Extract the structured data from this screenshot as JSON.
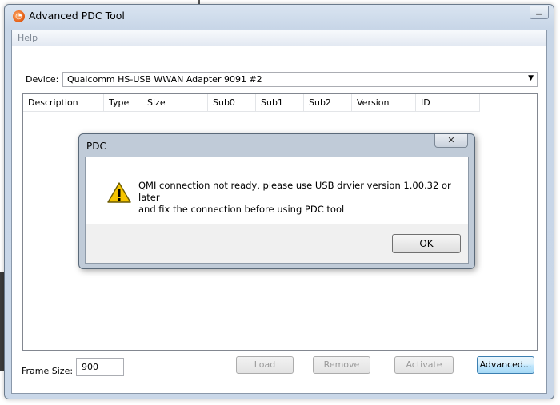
{
  "window": {
    "title": "Advanced PDC Tool"
  },
  "menu": {
    "help": "Help"
  },
  "device": {
    "label": "Device:",
    "value": "Qualcomm HS-USB WWAN Adapter 9091 #2"
  },
  "table": {
    "columns": [
      "Description",
      "Type",
      "Size",
      "Sub0",
      "Sub1",
      "Sub2",
      "Version",
      "ID"
    ]
  },
  "frame": {
    "label": "Frame Size:",
    "value": "900"
  },
  "buttons": {
    "load": "Load",
    "remove": "Remove",
    "activate": "Activate",
    "advanced": "Advanced..."
  },
  "dialog": {
    "title": "PDC",
    "line1": "QMI connection not ready, please use USB drvier version 1.00.32 or later",
    "line2": "and fix the connection before using PDC tool",
    "ok": "OK"
  }
}
